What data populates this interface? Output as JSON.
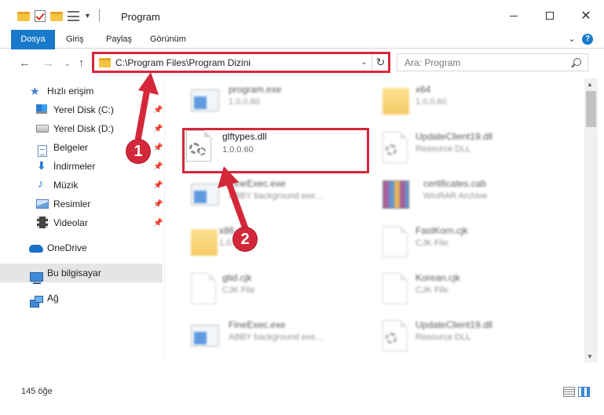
{
  "window": {
    "title": "Program"
  },
  "ribbon": {
    "tabs": [
      "Dosya",
      "Giriş",
      "Paylaş",
      "Görünüm"
    ],
    "help": "?"
  },
  "nav": {
    "address": "C:\\Program Files\\Program Dizini",
    "search_placeholder": "Ara: Program"
  },
  "sidebar": {
    "items": [
      {
        "label": "Hızlı erişim",
        "icon": "star-icon"
      },
      {
        "label": "Yerel Disk (C:)",
        "icon": "disk-c-icon"
      },
      {
        "label": "Yerel Disk (D:)",
        "icon": "disk-d-icon"
      },
      {
        "label": "Belgeler",
        "icon": "documents-icon"
      },
      {
        "label": "İndirmeler",
        "icon": "downloads-icon"
      },
      {
        "label": "Müzik",
        "icon": "music-icon"
      },
      {
        "label": "Resimler",
        "icon": "pictures-icon"
      },
      {
        "label": "Videolar",
        "icon": "videos-icon"
      },
      {
        "label": "OneDrive",
        "icon": "cloud-icon"
      },
      {
        "label": "Bu bilgisayar",
        "icon": "computer-icon"
      },
      {
        "label": "Ağ",
        "icon": "network-icon"
      }
    ]
  },
  "files": [
    {
      "name": "program.exe",
      "sub": "1.0.0.60",
      "icon": "exe-icon"
    },
    {
      "name": "x64",
      "sub": "1.0.0.60",
      "icon": "folder-icon"
    },
    {
      "name": "glftypes.dll",
      "sub": "1.0.0.60",
      "icon": "dll-icon"
    },
    {
      "name": "UpdateClient19.dll",
      "sub": "Resource DLL",
      "icon": "dll-icon"
    },
    {
      "name": "FineExec.exe",
      "sub": "ABBY background exe...",
      "icon": "exe-icon"
    },
    {
      "name": "certificates.cab",
      "sub": "WinRAR Archive",
      "icon": "archive-icon"
    },
    {
      "name": "x86",
      "sub": "1.0.0.60",
      "icon": "folder-icon"
    },
    {
      "name": "FastKorn.cjk",
      "sub": "CJK File",
      "icon": "file-icon"
    },
    {
      "name": "gtid.cjk",
      "sub": "CJK File",
      "icon": "file-icon"
    },
    {
      "name": "Korean.cjk",
      "sub": "CJK File",
      "icon": "file-icon"
    },
    {
      "name": "FineExec.exe",
      "sub": "ABBY background exe...",
      "icon": "exe-icon"
    },
    {
      "name": "UpdateClient19.dll",
      "sub": "Resource DLL",
      "icon": "dll-icon"
    }
  ],
  "status": {
    "count": "145 öğe"
  },
  "callouts": [
    "1",
    "2"
  ],
  "colors": {
    "accent": "#1979ca",
    "highlight": "#d4283a",
    "selected": "#e5e5e5"
  }
}
